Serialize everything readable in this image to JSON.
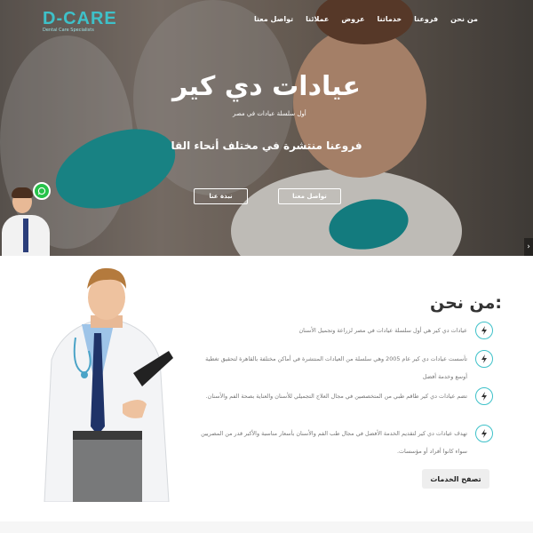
{
  "brand": {
    "name": "D-CARE",
    "tagline": "Dental Care Specialists"
  },
  "nav": {
    "items": [
      "من نحن",
      "فروعنا",
      "خدماتنا",
      "عروض",
      "عملائنا",
      "تواصل معنا"
    ]
  },
  "hero": {
    "title": "عيادات دي كير",
    "subtitle": "أول سلسلة عيادات في مصر",
    "branches": "فروعنا منتشرة في مختلف أنحاء القا",
    "contact_button": "تواصل معنا",
    "about_button": "نبذة عنا"
  },
  "about": {
    "title": "من نحن:",
    "features": [
      {
        "text": "عيادات دي كير هي أول سلسلة عيادات في مصر لزراعة وتجميل الأسنان"
      },
      {
        "text": "تأسست عيادات دي كير عام 2005 وهي سلسلة من العيادات المنتشرة في أماكن مختلفة بالقاهرة لتحقيق تغطية أوسع وخدمة أفضل"
      },
      {
        "text": "تضم عيادات دي كير طاقم طبي من المتخصصين في مجال العلاج التجميلي للأسنان والعناية بصحة الفم والأسنان."
      },
      {
        "text": "تهدف عيادات دي كير لتقديم الخدمة الأفضل في مجال طب الفم والأسنان بأسعار مناسبة والأكبر قدر من المصريين سواء كانوا أفراد أو مؤسسات."
      }
    ],
    "services_button": "تصفح الخدمات"
  },
  "colors": {
    "accent": "#3ec1c9",
    "whatsapp": "#27c24a"
  },
  "icons": [
    "bolt-icon",
    "whatsapp-icon",
    "chevron-right-icon"
  ]
}
